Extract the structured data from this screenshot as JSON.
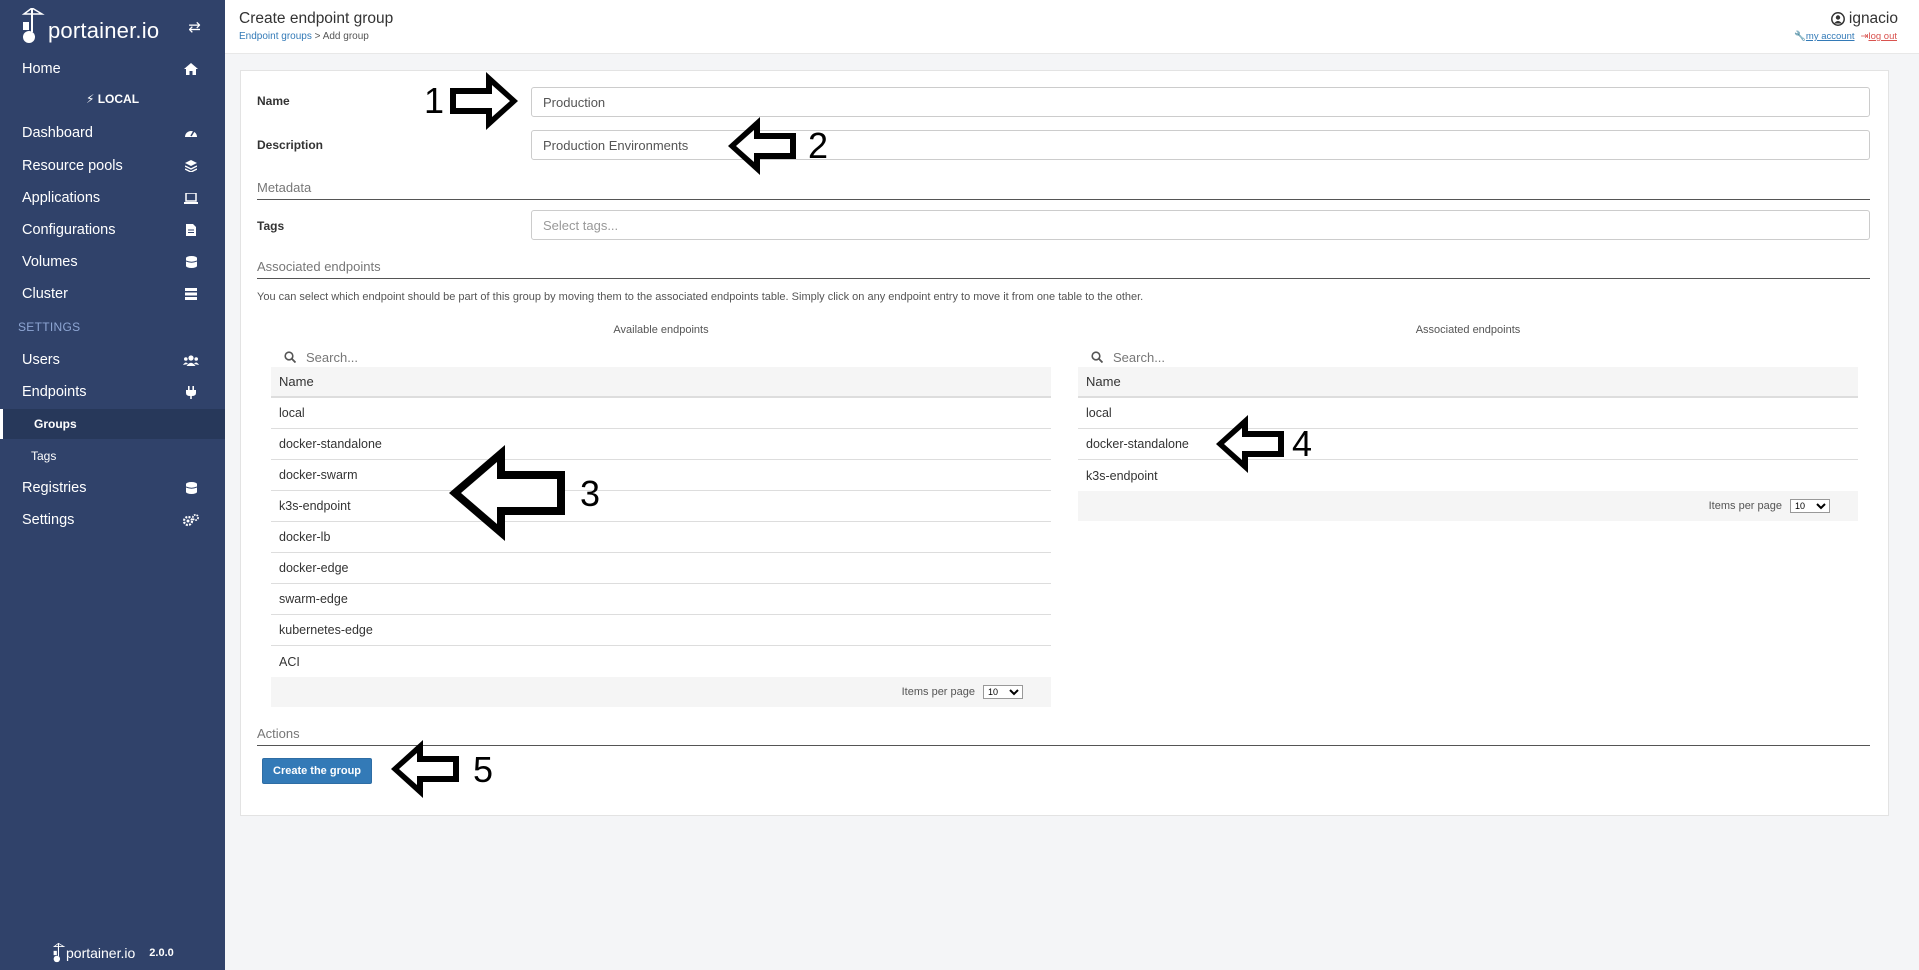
{
  "brand": {
    "name": "portainer.io"
  },
  "sidebar": {
    "home": "Home",
    "endpoint": "LOCAL",
    "items": [
      {
        "label": "Dashboard",
        "icon": "tachometer-icon"
      },
      {
        "label": "Resource pools",
        "icon": "layers-icon"
      },
      {
        "label": "Applications",
        "icon": "laptop-icon"
      },
      {
        "label": "Configurations",
        "icon": "file-icon"
      },
      {
        "label": "Volumes",
        "icon": "database-icon"
      },
      {
        "label": "Cluster",
        "icon": "server-icon"
      }
    ],
    "settings_title": "SETTINGS",
    "settings_items": [
      {
        "label": "Users",
        "icon": "users-icon"
      },
      {
        "label": "Endpoints",
        "icon": "plug-icon"
      }
    ],
    "sub_groups": "Groups",
    "sub_tags": "Tags",
    "registries": "Registries",
    "settings": "Settings",
    "footer_brand": "portainer.io",
    "version": "2.0.0"
  },
  "header": {
    "title": "Create endpoint group",
    "breadcrumb_link": "Endpoint groups",
    "breadcrumb_current": "> Add group",
    "username": "ignacio",
    "my_account": "my account",
    "log_out": "log out"
  },
  "form": {
    "name_label": "Name",
    "name_value": "Production",
    "description_label": "Description",
    "description_value": "Production Environments",
    "metadata_title": "Metadata",
    "tags_label": "Tags",
    "tags_placeholder": "Select tags...",
    "associated_title": "Associated endpoints",
    "help_text": "You can select which endpoint should be part of this group by moving them to the associated endpoints table. Simply click on any endpoint entry to move it from one table to the other.",
    "actions_title": "Actions",
    "create_button": "Create the group"
  },
  "available": {
    "caption": "Available endpoints",
    "search_placeholder": "Search...",
    "column": "Name",
    "rows": [
      "local",
      "docker-standalone",
      "docker-swarm",
      "k3s-endpoint",
      "docker-lb",
      "docker-edge",
      "swarm-edge",
      "kubernetes-edge",
      "ACI"
    ],
    "items_per_page": "Items per page",
    "page_size": "10"
  },
  "associated": {
    "caption": "Associated endpoints",
    "search_placeholder": "Search...",
    "column": "Name",
    "rows": [
      "local",
      "docker-standalone",
      "k3s-endpoint"
    ],
    "items_per_page": "Items per page",
    "page_size": "10"
  },
  "callouts": [
    "1",
    "2",
    "3",
    "4",
    "5"
  ]
}
